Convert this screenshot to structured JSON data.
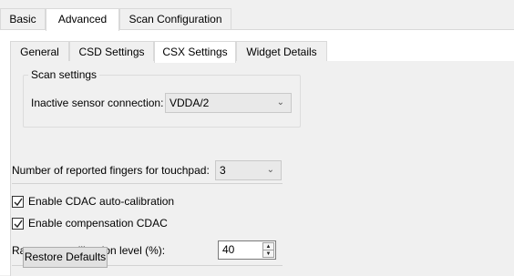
{
  "top_tabs": [
    "Basic",
    "Advanced",
    "Scan Configuration"
  ],
  "sub_tabs": [
    "General",
    "CSD Settings",
    "CSX Settings",
    "Widget Details"
  ],
  "scan_settings": {
    "group_title": "Scan settings",
    "inactive_label": "Inactive sensor connection:",
    "inactive_value": "VDDA/2"
  },
  "fingers": {
    "label": "Number of reported fingers for touchpad:",
    "value": "3"
  },
  "cdac_auto": {
    "label": "Enable CDAC auto-calibration",
    "checked": true
  },
  "comp_cdac": {
    "label": "Enable compensation CDAC",
    "checked": true
  },
  "raw_count": {
    "label": "Raw count calibration level (%):",
    "value": "40"
  },
  "restore_label": "Restore Defaults",
  "icons": {
    "dropdown": "chevron-down-icon",
    "checkbox": "check-icon",
    "spin_up": "spin-up-icon",
    "spin_down": "spin-down-icon"
  }
}
